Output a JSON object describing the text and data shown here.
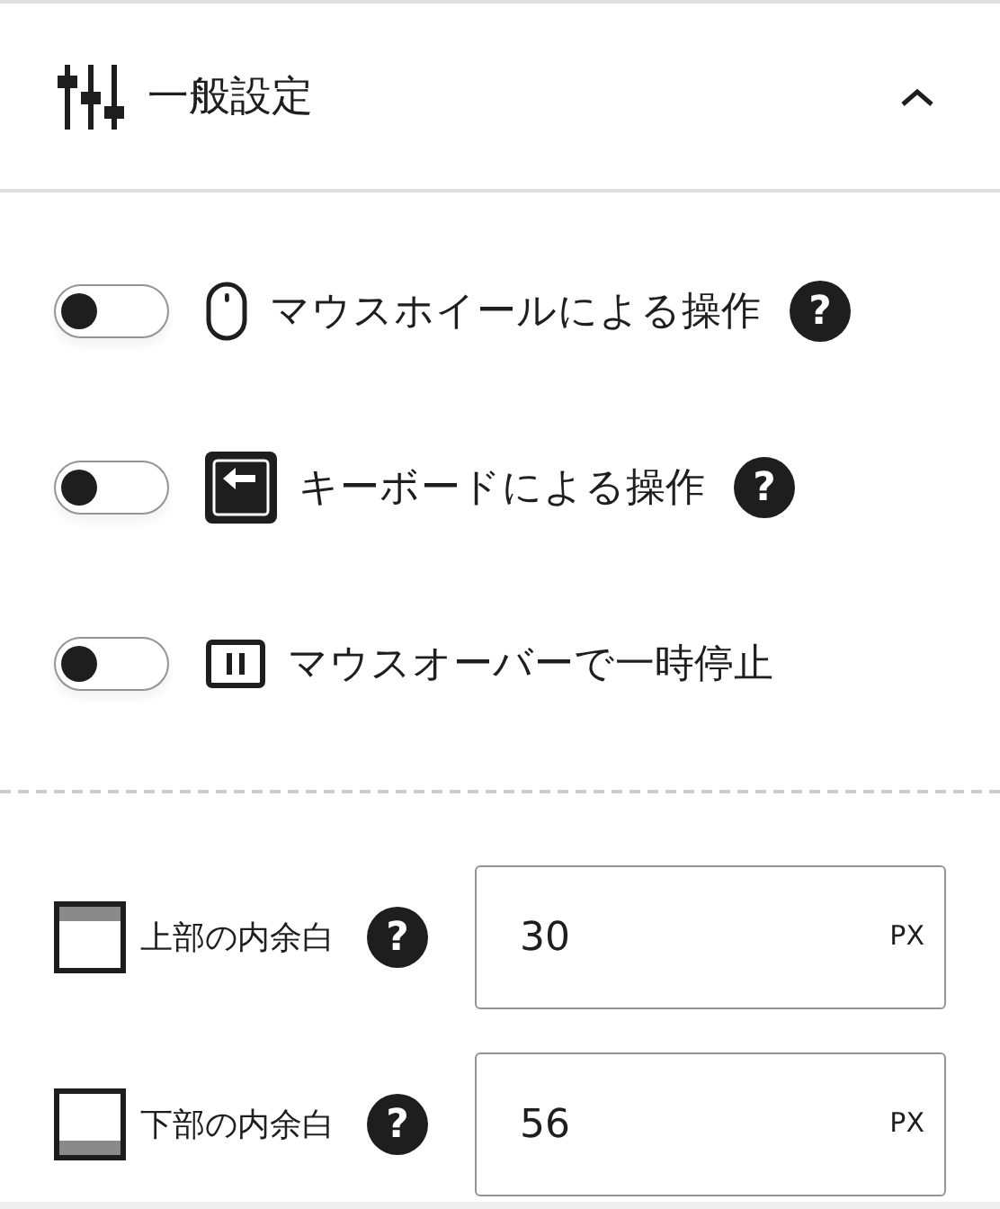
{
  "panel": {
    "title": "一般設定",
    "expanded": true
  },
  "toggles": [
    {
      "kind": "mouse",
      "label": "マウスホイールによる操作",
      "on": false,
      "help": "?"
    },
    {
      "kind": "keyboard",
      "label": "キーボードによる操作",
      "on": false,
      "help": "?"
    },
    {
      "kind": "pause",
      "label": "マウスオーバーで一時停止",
      "on": false
    }
  ],
  "paddings": [
    {
      "kind": "top",
      "label": "上部の内余白",
      "help": "?",
      "value": "30",
      "unit": "PX"
    },
    {
      "kind": "bottom",
      "label": "下部の内余白",
      "help": "?",
      "value": "56",
      "unit": "PX"
    }
  ]
}
